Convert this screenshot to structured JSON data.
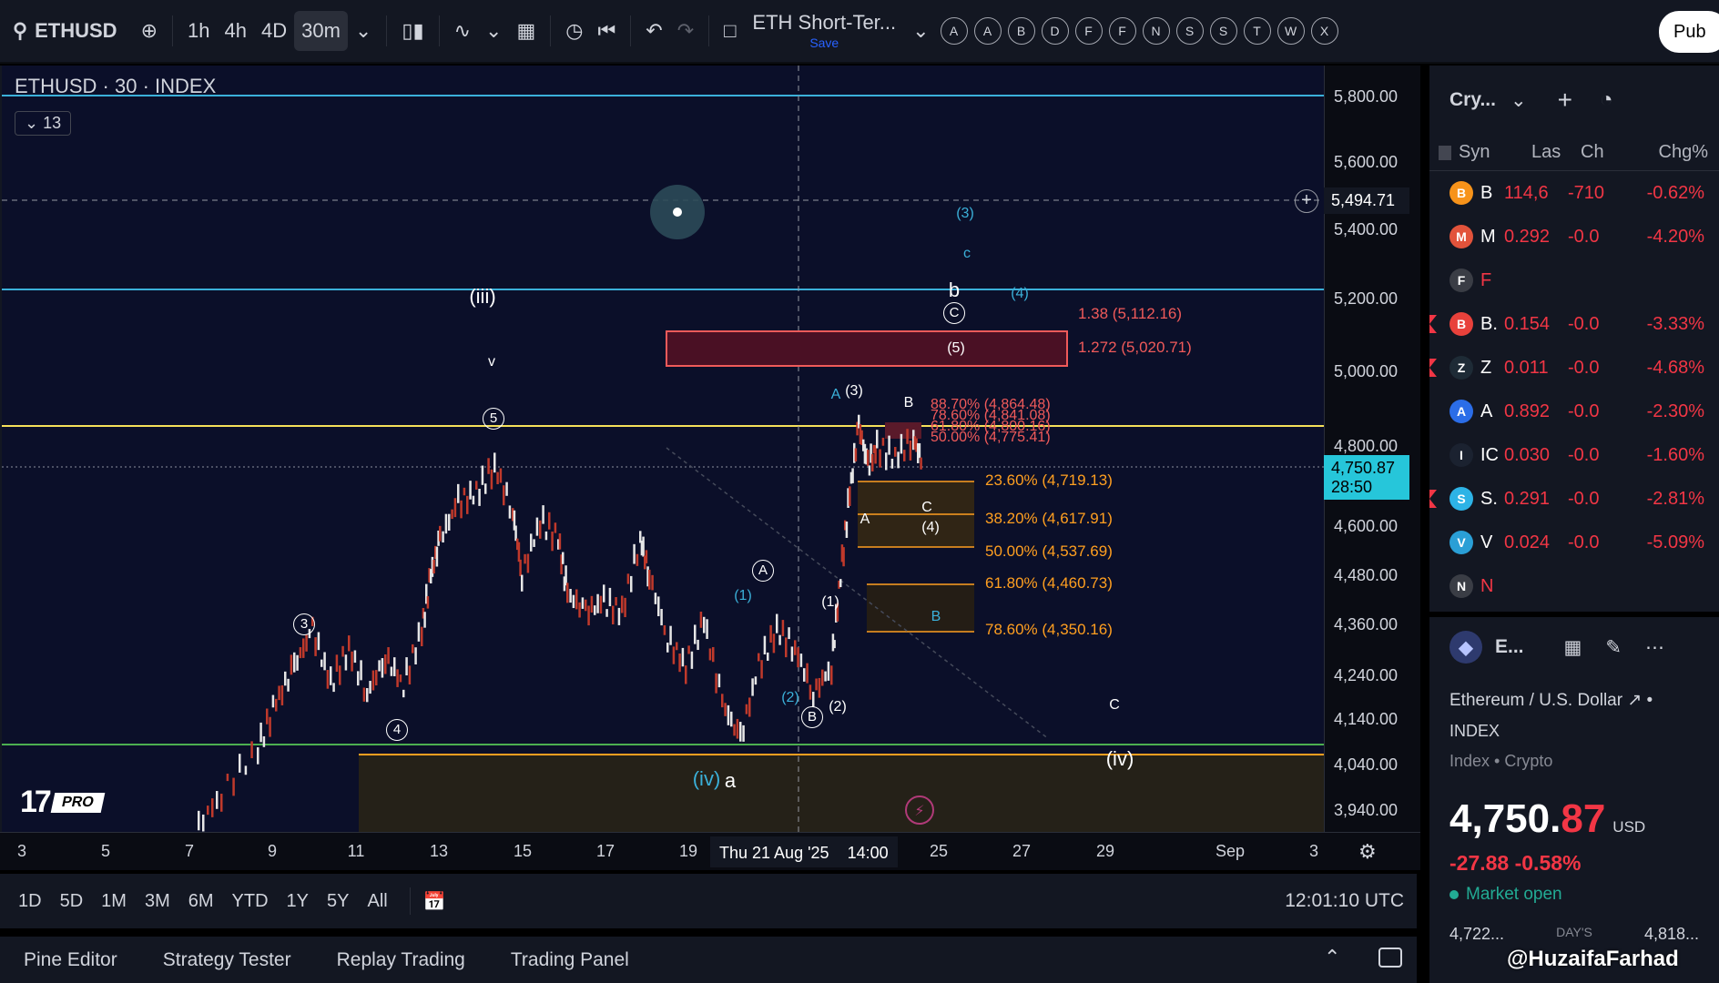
{
  "toolbar": {
    "symbol": "ETHUSD",
    "intervals": [
      "1h",
      "4h",
      "4D",
      "30m"
    ],
    "active_interval": "30m",
    "layout_name": "ETH Short-Ter...",
    "layout_save": "Save",
    "alert_letters": [
      "A",
      "A",
      "B",
      "D",
      "F",
      "F",
      "N",
      "S",
      "S",
      "T",
      "W",
      "X"
    ],
    "publish_label": "Pub"
  },
  "chart": {
    "legend": "ETHUSD · 30 · INDEX",
    "collapse_count": "13",
    "price_labels": [
      "5,800.00",
      "5,600.00",
      "5,400.00",
      "5,200.00",
      "5,000.00",
      "4,800.00",
      "4,600.00",
      "4,480.00",
      "4,360.00",
      "4,240.00",
      "4,140.00",
      "4,040.00",
      "3,940.00"
    ],
    "crosshair_price": "5,494.71",
    "last_price": "4,750.87",
    "countdown": "28:50",
    "time_labels": [
      "3",
      "5",
      "7",
      "9",
      "11",
      "13",
      "15",
      "17",
      "19",
      "25",
      "27",
      "29",
      "Sep",
      "3"
    ],
    "crosshair_date": "Thu 21 Aug '25",
    "crosshair_time": "14:00",
    "fib_upper": [
      "1.38 (5,112.16)",
      "1.272 (5,020.71)"
    ],
    "fib_cluster": [
      "88.70% (4,864.48)",
      "78.60% (4,841.08)",
      "61.80% (4,800.16)",
      "50.00% (4,775.41)"
    ],
    "fib_lower": [
      "23.60% (4,719.13)",
      "38.20% (4,617.91)",
      "50.00% (4,537.69)",
      "61.80% (4,460.73)",
      "78.60% (4,350.16)"
    ],
    "wave_labels": {
      "iii": "(iii)",
      "iv": "(iv)",
      "iv_cyan": "(iv)",
      "a": "a",
      "b": "b",
      "v": "v",
      "c_circ": "C",
      "A_circ": "A",
      "B_circ": "B",
      "w3": "3",
      "w4": "4",
      "w5": "5",
      "p1": "(1)",
      "p2": "(2)",
      "p3": "(3)",
      "p4": "(4)",
      "p5": "(5)",
      "A": "A",
      "B": "B",
      "C": "C",
      "c": "c"
    },
    "brand": "PRO"
  },
  "range_bar": {
    "ranges": [
      "1D",
      "5D",
      "1M",
      "3M",
      "6M",
      "YTD",
      "1Y",
      "5Y",
      "All"
    ],
    "clock": "12:01:10 UTC"
  },
  "panel_tabs": [
    "Pine Editor",
    "Strategy Tester",
    "Replay Trading",
    "Trading Panel"
  ],
  "watchlist": {
    "title": "Cry...",
    "columns": [
      "Syn",
      "Las",
      "Ch",
      "Chg%"
    ],
    "rows": [
      {
        "icon": "B",
        "color": "#f7931a",
        "sym": "B",
        "last": "114,6",
        "ch": "-710",
        "chg": "-0.62%",
        "flag": false
      },
      {
        "icon": "M",
        "color": "#e2533b",
        "sym": "M",
        "last": "0.292",
        "ch": "-0.0",
        "chg": "-4.20%",
        "flag": false
      },
      {
        "icon": "F",
        "color": "#3a3d45",
        "sym": "F",
        "last": "",
        "ch": "",
        "chg": "",
        "flag": false
      },
      {
        "icon": "B",
        "color": "#e8413b",
        "sym": "B.",
        "last": "0.154",
        "ch": "-0.0",
        "chg": "-3.33%",
        "flag": true
      },
      {
        "icon": "Z",
        "color": "#1e2b36",
        "sym": "Z",
        "last": "0.011",
        "ch": "-0.0",
        "chg": "-4.68%",
        "flag": true
      },
      {
        "icon": "A",
        "color": "#2b6de8",
        "sym": "A",
        "last": "0.892",
        "ch": "-0.0",
        "chg": "-2.30%",
        "flag": false
      },
      {
        "icon": "I",
        "color": "#1b2230",
        "sym": "IC",
        "last": "0.030",
        "ch": "-0.0",
        "chg": "-1.60%",
        "flag": false
      },
      {
        "icon": "S",
        "color": "#2db3e6",
        "sym": "S.",
        "last": "0.291",
        "ch": "-0.0",
        "chg": "-2.81%",
        "flag": true
      },
      {
        "icon": "V",
        "color": "#2a9fd6",
        "sym": "V",
        "last": "0.024",
        "ch": "-0.0",
        "chg": "-5.09%",
        "flag": false
      },
      {
        "icon": "N",
        "color": "#3a3d45",
        "sym": "N",
        "last": "",
        "ch": "",
        "chg": "",
        "flag": false
      }
    ]
  },
  "details": {
    "short": "E...",
    "name": "Ethereum / U.S. Dollar",
    "exchange": "INDEX",
    "type": "Index • Crypto",
    "price_int": "4,750.",
    "price_dec": "87",
    "currency": "USD",
    "change": "-27.88  -0.58%",
    "status": "Market open",
    "range_low": "4,722...",
    "range_label": "DAY'S",
    "range_high": "4,818..."
  },
  "watermark": "@HuzaifaFarhad",
  "colors": {
    "bg": "#0b0f29",
    "red": "#f23645",
    "cyan": "#3bb0d9",
    "orange": "#ff9f20",
    "yellow": "#f5e05a",
    "green": "#4caf50"
  }
}
